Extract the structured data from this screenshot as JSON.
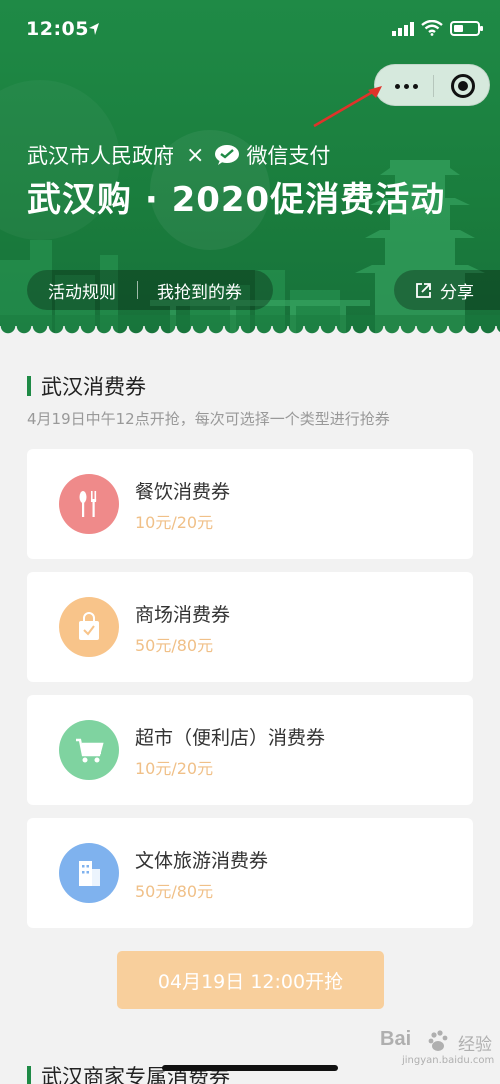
{
  "status_bar": {
    "time": "12:05"
  },
  "header": {
    "partner_left": "武汉市人民政府",
    "partner_separator": "×",
    "partner_right": "微信支付",
    "title": "武汉购 · 2020促消费活动",
    "rules_link": "活动规则",
    "my_coupons_link": "我抢到的券",
    "share_label": "分享"
  },
  "section1": {
    "title": "武汉消费券",
    "description": "4月19日中午12点开抢，每次可选择一个类型进行抢券"
  },
  "coupons": [
    {
      "name": "餐饮消费券",
      "price": "10元/20元",
      "color": "#ef8a8a",
      "icon": "utensils-icon"
    },
    {
      "name": "商场消费券",
      "price": "50元/80元",
      "color": "#f8c48a",
      "icon": "shopping-bag-icon"
    },
    {
      "name": "超市（便利店）消费券",
      "price": "10元/20元",
      "color": "#7fd3a0",
      "icon": "shopping-cart-icon"
    },
    {
      "name": "文体旅游消费券",
      "price": "50元/80元",
      "color": "#7fb2ee",
      "icon": "building-icon"
    }
  ],
  "grab_button": "04月19日 12:00开抢",
  "section2": {
    "title": "武汉商家专属消费券"
  },
  "watermark": {
    "brand": "Bai",
    "brand2": "经验",
    "url": "jingyan.baidu.com"
  },
  "colors": {
    "brand_green": "#1f8a46",
    "price_orange": "#f0c088",
    "button_peach": "#f8cf9c"
  }
}
